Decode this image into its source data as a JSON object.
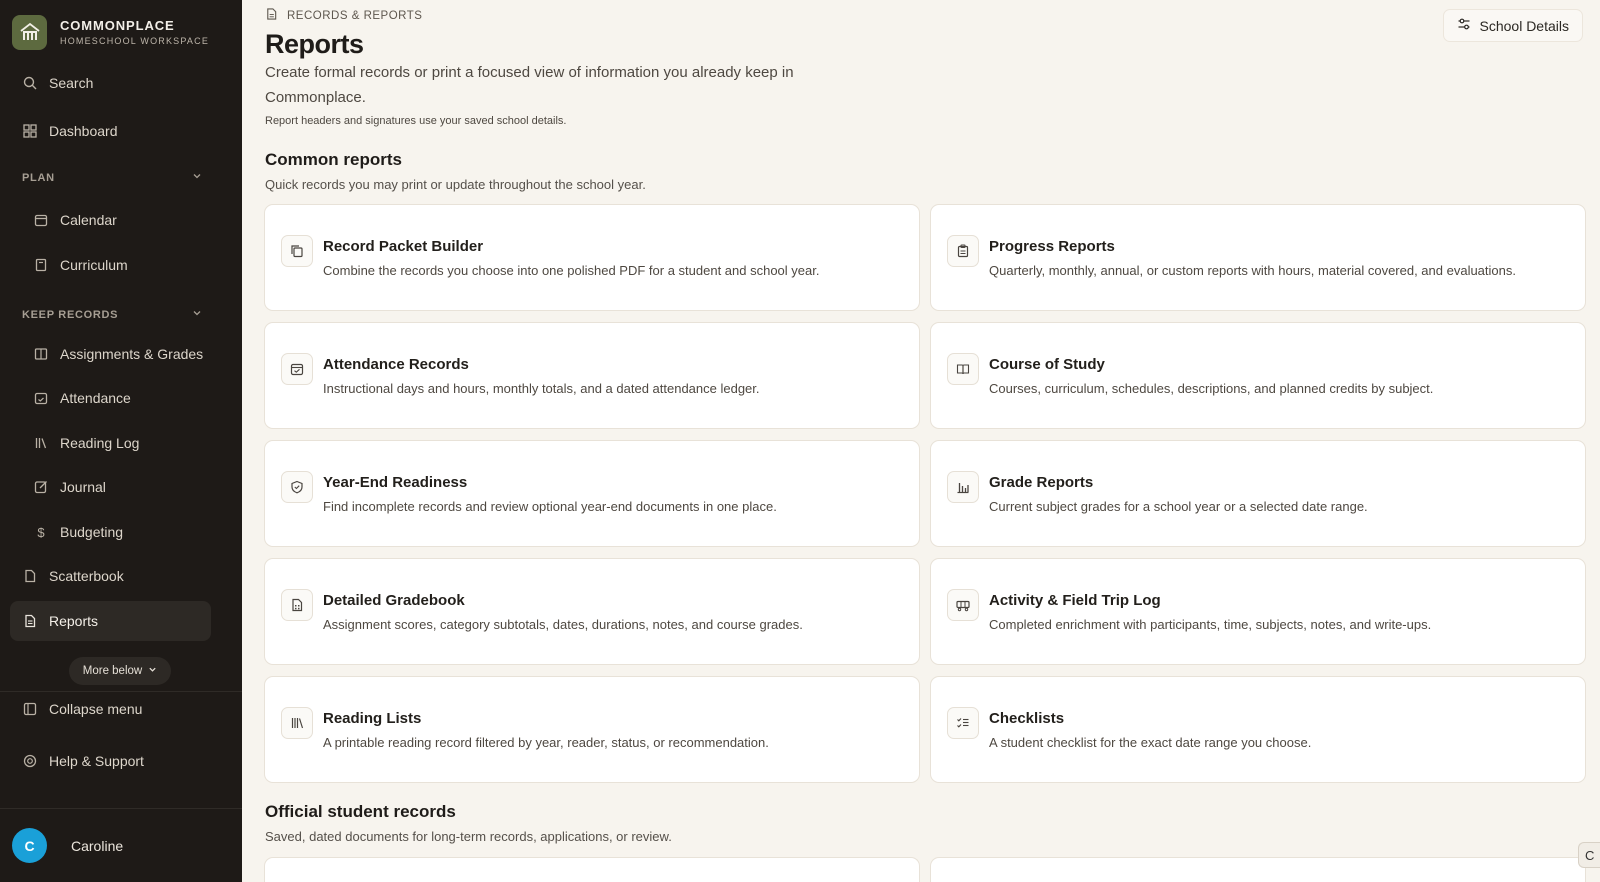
{
  "brand": {
    "title": "COMMONPLACE",
    "subtitle": "HOMESCHOOL WORKSPACE"
  },
  "sidebar": {
    "search": "Search",
    "dashboard": "Dashboard",
    "plan_label": "PLAN",
    "plan_items": [
      "Calendar",
      "Curriculum"
    ],
    "keep_label": "KEEP RECORDS",
    "keep_items": [
      "Assignments & Grades",
      "Attendance",
      "Reading Log",
      "Journal",
      "Budgeting"
    ],
    "scatterbook": "Scatterbook",
    "reports": "Reports",
    "more_below": "More below",
    "collapse": "Collapse menu",
    "help": "Help & Support"
  },
  "user": {
    "initial": "C",
    "name": "Caroline",
    "avatar_color": "#1aa0d8"
  },
  "header": {
    "breadcrumb": "RECORDS & REPORTS",
    "school_button": "School Details",
    "title": "Reports",
    "description": "Create formal records or print a focused view of information you already keep in Commonplace.",
    "note": "Report headers and signatures use your saved school details."
  },
  "common": {
    "title": "Common reports",
    "subtitle": "Quick records you may print or update throughout the school year.",
    "cards": [
      {
        "icon": "copy-icon",
        "title": "Record Packet Builder",
        "desc": "Combine the records you choose into one polished PDF for a student and school year."
      },
      {
        "icon": "clipboard-icon",
        "title": "Progress Reports",
        "desc": "Quarterly, monthly, annual, or custom reports with hours, material covered, and evaluations."
      },
      {
        "icon": "calendar-check-icon",
        "title": "Attendance Records",
        "desc": "Instructional days and hours, monthly totals, and a dated attendance ledger."
      },
      {
        "icon": "book-open-icon",
        "title": "Course of Study",
        "desc": "Courses, curriculum, schedules, descriptions, and planned credits by subject."
      },
      {
        "icon": "shield-check-icon",
        "title": "Year-End Readiness",
        "desc": "Find incomplete records and review optional year-end documents in one place."
      },
      {
        "icon": "bar-chart-icon",
        "title": "Grade Reports",
        "desc": "Current subject grades for a school year or a selected date range."
      },
      {
        "icon": "gradebook-icon",
        "title": "Detailed Gradebook",
        "desc": "Assignment scores, category subtotals, dates, durations, notes, and course grades."
      },
      {
        "icon": "ticket-icon",
        "title": "Activity & Field Trip Log",
        "desc": "Completed enrichment with participants, time, subjects, notes, and write-ups."
      },
      {
        "icon": "library-icon",
        "title": "Reading Lists",
        "desc": "A printable reading record filtered by year, reader, status, or recommendation."
      },
      {
        "icon": "checklist-icon",
        "title": "Checklists",
        "desc": "A student checklist for the exact date range you choose."
      }
    ]
  },
  "official": {
    "title": "Official student records",
    "subtitle": "Saved, dated documents for long-term records, applications, or review."
  },
  "floating_chip": "C"
}
